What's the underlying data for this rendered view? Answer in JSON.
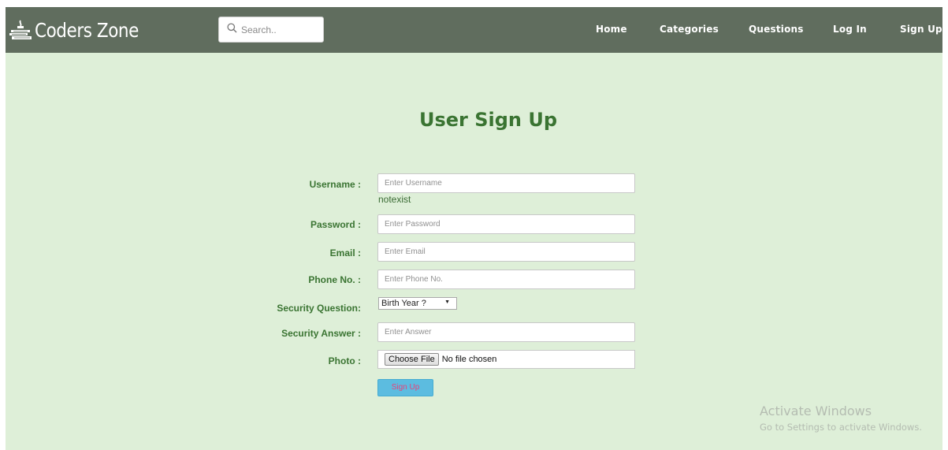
{
  "navbar": {
    "brand": "Coders Zone",
    "search": {
      "placeholder": "Search..",
      "value": ""
    },
    "links": [
      "Home",
      "Categories",
      "Questions",
      "Log In",
      "Sign Up"
    ]
  },
  "page": {
    "title": "User Sign Up"
  },
  "form": {
    "username": {
      "label": "Username :",
      "placeholder": "Enter Username",
      "value": "",
      "note": "notexist"
    },
    "password": {
      "label": "Password :",
      "placeholder": "Enter Password",
      "value": ""
    },
    "email": {
      "label": "Email :",
      "placeholder": "Enter Email",
      "value": ""
    },
    "phone": {
      "label": "Phone No. :",
      "placeholder": "Enter Phone No.",
      "value": ""
    },
    "security_question": {
      "label": "Security Question:",
      "selected": "Birth Year ?"
    },
    "security_answer": {
      "label": "Security Answer :",
      "placeholder": "Enter Answer",
      "value": ""
    },
    "photo": {
      "label": "Photo :",
      "button": "Choose File",
      "status": "No file chosen"
    },
    "submit_label": "Sign Up"
  },
  "watermark": {
    "title": "Activate Windows",
    "subtitle": "Go to Settings to activate Windows."
  },
  "icons": {
    "brand": "books-lamp-icon",
    "search": "search-icon",
    "select_arrow": "caret-down-icon"
  },
  "colors": {
    "navbar_bg": "#606d5e",
    "page_bg": "#deefd8",
    "label_green": "#3a7432",
    "submit_bg": "#5cbce0",
    "submit_text": "#e8437a"
  }
}
